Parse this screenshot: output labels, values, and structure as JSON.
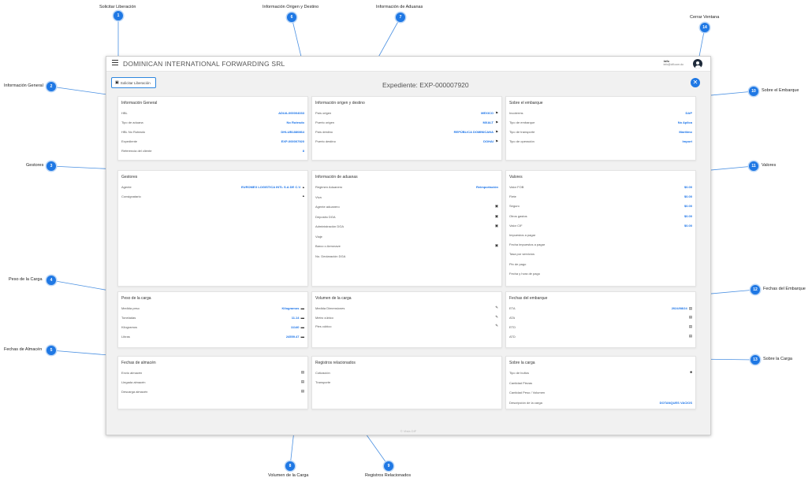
{
  "app": {
    "company": "DOMINICAN INTERNATIONAL FORWARDING SRL",
    "user_name": "info",
    "user_email": "info@dif.com.do",
    "release_button": "Solicitar Liberación",
    "expediente_title": "Expediente: EXP-000007920",
    "footer": "© Vista DIF"
  },
  "cards": {
    "general": {
      "title": "Información General",
      "rows": [
        {
          "label": "HBL",
          "value": "ADUA-000004033"
        },
        {
          "label": "Tipo de aduana",
          "value": "No Rutesdo"
        },
        {
          "label": "HBL No Ruteado",
          "value": "DHLUB1880864"
        },
        {
          "label": "Expediente",
          "value": "EXP-000007920"
        },
        {
          "label": "Referencia del cliente",
          "value": "8"
        }
      ]
    },
    "origin": {
      "title": "Información origen y destino",
      "rows": [
        {
          "label": "País origen",
          "value": "MEXICO"
        },
        {
          "label": "Puerto origen",
          "value": "MXALT"
        },
        {
          "label": "País destino",
          "value": "REPÚBLICA DOMINICANA"
        },
        {
          "label": "Puerto destino",
          "value": "DOHAI"
        }
      ]
    },
    "shipment": {
      "title": "Sobre el embarque",
      "rows": [
        {
          "label": "Incoterms",
          "value": "DAP"
        },
        {
          "label": "Tipo de embarque",
          "value": "No Aplica"
        },
        {
          "label": "Tipo de transporte",
          "value": "Marítimo"
        },
        {
          "label": "Tipo de operación",
          "value": "Import"
        }
      ]
    },
    "managers": {
      "title": "Gestores",
      "rows": [
        {
          "label": "Agente",
          "value": "EUROMEX LOGISTICA INTL S.A DE C.V."
        },
        {
          "label": "Consignatario",
          "value": ""
        }
      ]
    },
    "customs": {
      "title": "Información de aduanas",
      "rows": [
        {
          "label": "Regimen Aduanero",
          "value": "Reimportación"
        },
        {
          "label": "Viva",
          "value": ""
        },
        {
          "label": "Agente aduanero",
          "value": ""
        },
        {
          "label": "Deposito DGA",
          "value": ""
        },
        {
          "label": "Administración DGA",
          "value": ""
        },
        {
          "label": "Viaje",
          "value": ""
        },
        {
          "label": "Barco o Aeronave",
          "value": ""
        },
        {
          "label": "No. Declaración DGA",
          "value": ""
        }
      ]
    },
    "values": {
      "title": "Valores",
      "rows": [
        {
          "label": "Valor FOB",
          "value": "$0.00"
        },
        {
          "label": "Flete",
          "value": "$0.00"
        },
        {
          "label": "Seguro",
          "value": "$0.00"
        },
        {
          "label": "Otros gastos",
          "value": "$0.00"
        },
        {
          "label": "Valor CIF",
          "value": "$0.00"
        },
        {
          "label": "Impuestos a pagar",
          "value": ""
        },
        {
          "label": "Fecha impuestos a pagar",
          "value": ""
        },
        {
          "label": "Tasa por servicios",
          "value": ""
        },
        {
          "label": "Pin de pago",
          "value": ""
        },
        {
          "label": "Fecha y hora de pago",
          "value": ""
        }
      ]
    },
    "weight": {
      "title": "Peso de la carga",
      "rows": [
        {
          "label": "Medida peso",
          "value": "Kilogramos"
        },
        {
          "label": "Toneladas",
          "value": "11.14"
        },
        {
          "label": "Kilogramos",
          "value": "11140"
        },
        {
          "label": "Libras",
          "value": "24559.47"
        }
      ]
    },
    "volume": {
      "title": "Volumen de la carga",
      "rows": [
        {
          "label": "Medida Dimensiones",
          "value": ""
        },
        {
          "label": "Metro cúbico",
          "value": ""
        },
        {
          "label": "Pies cúbico",
          "value": ""
        }
      ]
    },
    "dates_shipment": {
      "title": "Fechas del embarque",
      "rows": [
        {
          "label": "ETA",
          "value": "2024/08/24"
        },
        {
          "label": "ATA",
          "value": ""
        },
        {
          "label": "ETD",
          "value": ""
        },
        {
          "label": "ATD",
          "value": ""
        }
      ]
    },
    "dates_storage": {
      "title": "Fechas de almacén",
      "rows": [
        {
          "label": "Envio almacén",
          "value": ""
        },
        {
          "label": "Llegada almacén",
          "value": ""
        },
        {
          "label": "Descarga almacén",
          "value": ""
        }
      ]
    },
    "records": {
      "title": "Registros relacionados",
      "rows": [
        {
          "label": "Cotización",
          "value": ""
        },
        {
          "label": "Transporte",
          "value": ""
        }
      ]
    },
    "cargo": {
      "title": "Sobre la carga",
      "rows": [
        {
          "label": "Tipo de bultos",
          "value": ""
        },
        {
          "label": "Cantidad Piezas",
          "value": ""
        },
        {
          "label": "Cantidad Peso / Volumen",
          "value": ""
        },
        {
          "label": "Descripción de la carga",
          "value": "DOTANQUES VACIOS"
        }
      ]
    }
  },
  "callouts": [
    {
      "num": "1",
      "label": "Solicitar Liberación"
    },
    {
      "num": "2",
      "label": "Información General"
    },
    {
      "num": "3",
      "label": "Gestores"
    },
    {
      "num": "4",
      "label": "Peso de la Carga"
    },
    {
      "num": "5",
      "label": "Fechas de Almacén"
    },
    {
      "num": "6",
      "label": "Información Origen y Destino"
    },
    {
      "num": "7",
      "label": "Información de Aduanas"
    },
    {
      "num": "8",
      "label": "Volumen de la Carga"
    },
    {
      "num": "9",
      "label": "Registros Relacionados"
    },
    {
      "num": "10",
      "label": "Sobre el Embarque"
    },
    {
      "num": "11",
      "label": "Valores"
    },
    {
      "num": "12",
      "label": "Fechas del Embarque"
    },
    {
      "num": "13",
      "label": "Sobre la Carga"
    },
    {
      "num": "14",
      "label": "Cerrar Ventana"
    }
  ],
  "icons": {
    "flag": "flag-icon",
    "user": "user-icon",
    "building": "building-icon",
    "balance": "scale-icon",
    "pencil": "pencil-icon",
    "calendar": "calendar-icon",
    "box": "box-icon",
    "close": "close-icon",
    "release": "release-icon"
  },
  "colors": {
    "accent": "#1f78e4",
    "value_text": "#1a73e8"
  }
}
